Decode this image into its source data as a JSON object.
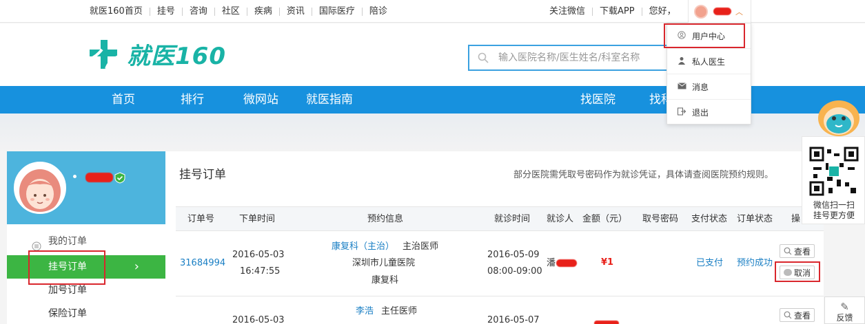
{
  "topbar": {
    "nav": [
      "就医160首页",
      "挂号",
      "咨询",
      "社区",
      "疾病",
      "资讯",
      "国际医疗",
      "陪诊"
    ],
    "follow_wechat": "关注微信",
    "download_app": "下载APP",
    "greeting": "您好，"
  },
  "header": {
    "logo_text": "就医160",
    "search_placeholder": "输入医院名称/医生姓名/科室名称"
  },
  "mainnav": {
    "left": [
      "首页",
      "排行",
      "微网站",
      "就医指南"
    ],
    "right": [
      "找医院",
      "找科"
    ]
  },
  "dropdown": {
    "items": [
      {
        "label": "用户中心",
        "icon": "user-icon"
      },
      {
        "label": "私人医生",
        "icon": "doctor-icon"
      },
      {
        "label": "消息",
        "icon": "mail-icon"
      },
      {
        "label": "退出",
        "icon": "logout-icon"
      }
    ]
  },
  "sidebar": {
    "section_title": "我的订单",
    "items": [
      "挂号订单",
      "加号订单",
      "保险订单"
    ],
    "active_arrow": "›"
  },
  "panel": {
    "title": "挂号订单",
    "note": "部分医院需凭取号密码作为就诊凭证，具体请查阅医院预约规则。"
  },
  "table": {
    "headers": [
      "订单号",
      "下单时间",
      "预约信息",
      "就诊时间",
      "就诊人",
      "金额（元）",
      "取号密码",
      "支付状态",
      "订单状态",
      "操"
    ],
    "rows": [
      {
        "order_no": "31684994",
        "order_date": "2016-05-03",
        "order_time": "16:47:55",
        "doctor": "康复科（主治）",
        "title": "主治医师",
        "hospital": "深圳市儿童医院",
        "dept": "康复科",
        "visit_date": "2016-05-09",
        "visit_time": "08:00-09:00",
        "patient": "潘",
        "amount": "¥1",
        "pay_status": "已支付",
        "order_status": "预约成功",
        "view": "查看",
        "cancel": "取消"
      },
      {
        "doctor": "李浩",
        "title": "主任医师",
        "order_date": "2016-05-03",
        "visit_date": "2016-05-07",
        "view": "查看"
      }
    ]
  },
  "qr": {
    "line1": "微信扫一扫",
    "line2": "挂号更方便"
  },
  "feedback": "反馈",
  "colors": {
    "nav_blue": "#1791de",
    "brand_teal": "#19b3a6",
    "active_green": "#3cb543",
    "highlight_red": "#d9262c"
  }
}
